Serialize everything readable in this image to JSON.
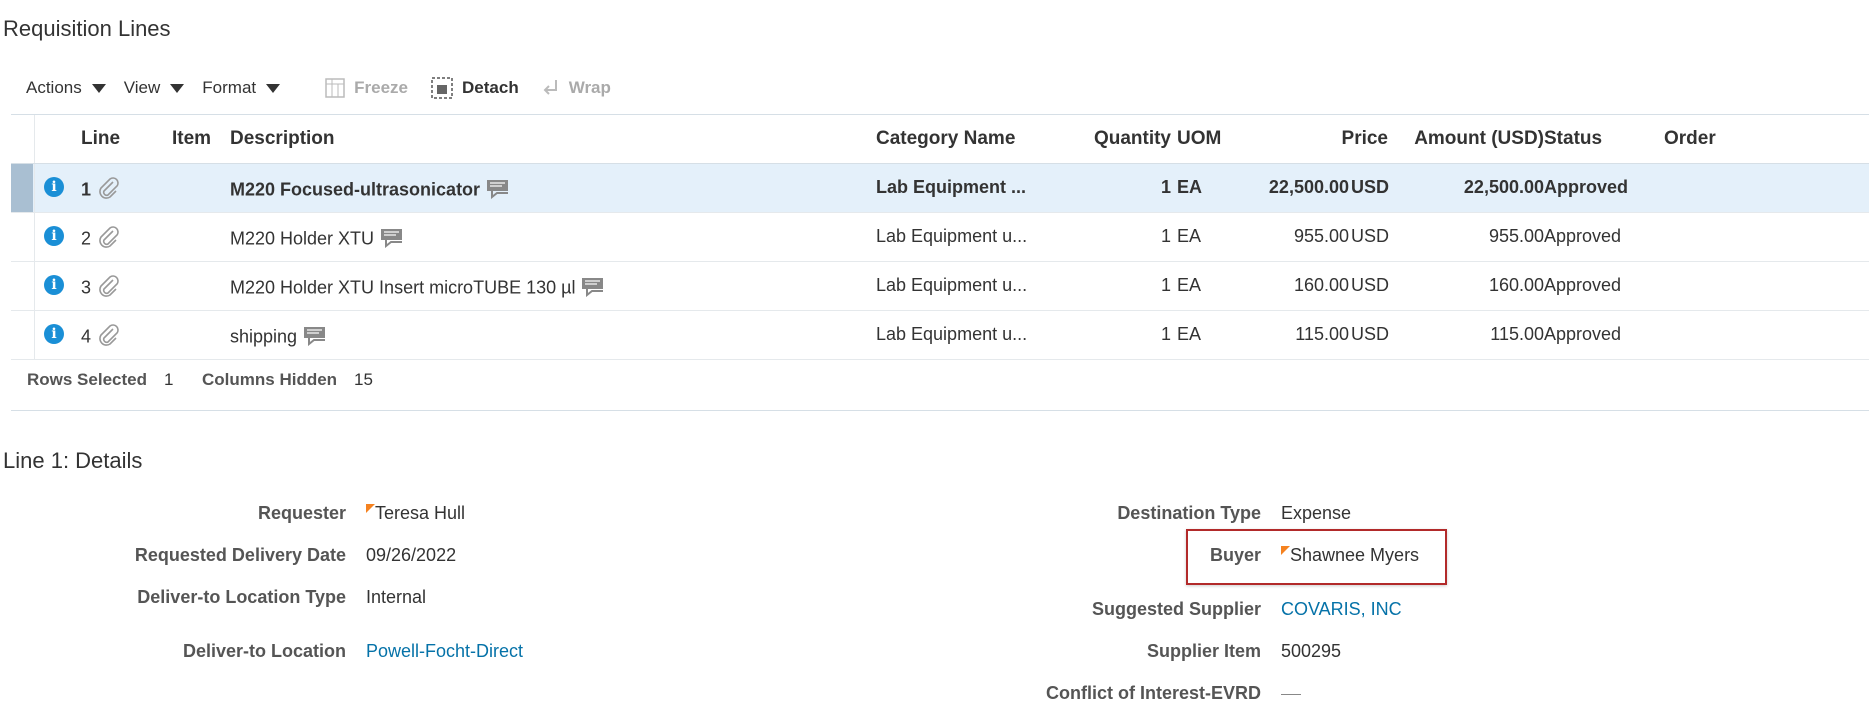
{
  "page": {
    "title": "Requisition Lines",
    "details_title": "Line 1: Details"
  },
  "toolbar": {
    "actions_label": "Actions",
    "view_label": "View",
    "format_label": "Format",
    "freeze_label": "Freeze",
    "detach_label": "Detach",
    "wrap_label": "Wrap"
  },
  "table": {
    "columns": {
      "line": "Line",
      "item": "Item",
      "description": "Description",
      "category": "Category Name",
      "quantity": "Quantity",
      "uom": "UOM",
      "price": "Price",
      "amount": "Amount (USD)",
      "status": "Status",
      "order": "Order"
    },
    "rows": [
      {
        "line": "1",
        "item": "",
        "description": "M220 Focused-ultrasonicator",
        "category": "Lab Equipment ...",
        "quantity": "1",
        "uom": "EA",
        "price": "22,500.00",
        "currency": "USD",
        "amount": "22,500.00",
        "status": "Approved",
        "order": ""
      },
      {
        "line": "2",
        "item": "",
        "description": "M220 Holder XTU",
        "category": "Lab Equipment u...",
        "quantity": "1",
        "uom": "EA",
        "price": "955.00",
        "currency": "USD",
        "amount": "955.00",
        "status": "Approved",
        "order": ""
      },
      {
        "line": "3",
        "item": "",
        "description": "M220 Holder XTU Insert microTUBE 130 µl",
        "category": "Lab Equipment u...",
        "quantity": "1",
        "uom": "EA",
        "price": "160.00",
        "currency": "USD",
        "amount": "160.00",
        "status": "Approved",
        "order": ""
      },
      {
        "line": "4",
        "item": "",
        "description": "shipping",
        "category": "Lab Equipment u...",
        "quantity": "1",
        "uom": "EA",
        "price": "115.00",
        "currency": "USD",
        "amount": "115.00",
        "status": "Approved",
        "order": ""
      }
    ],
    "footer": {
      "rows_selected_label": "Rows Selected",
      "rows_selected_value": "1",
      "columns_hidden_label": "Columns Hidden",
      "columns_hidden_value": "15"
    }
  },
  "details": {
    "requester_label": "Requester",
    "requester_value": "Teresa Hull",
    "delivery_date_label": "Requested Delivery Date",
    "delivery_date_value": "09/26/2022",
    "location_type_label": "Deliver-to Location Type",
    "location_type_value": "Internal",
    "location_label": "Deliver-to Location",
    "location_value": "Powell-Focht-Direct",
    "destination_type_label": "Destination Type",
    "destination_type_value": "Expense",
    "buyer_label": "Buyer",
    "buyer_value": "Shawnee Myers",
    "supplier_label": "Suggested Supplier",
    "supplier_value": "COVARIS, INC",
    "supplier_item_label": "Supplier Item",
    "supplier_item_value": "500295",
    "conflict_label": "Conflict of Interest-EVRD"
  },
  "colors": {
    "accent_link": "#0572a8",
    "info_icon": "#1a8fd6",
    "selected_row": "#e4f0fa",
    "highlight_border": "#b22a2a",
    "flag": "#f58220"
  }
}
